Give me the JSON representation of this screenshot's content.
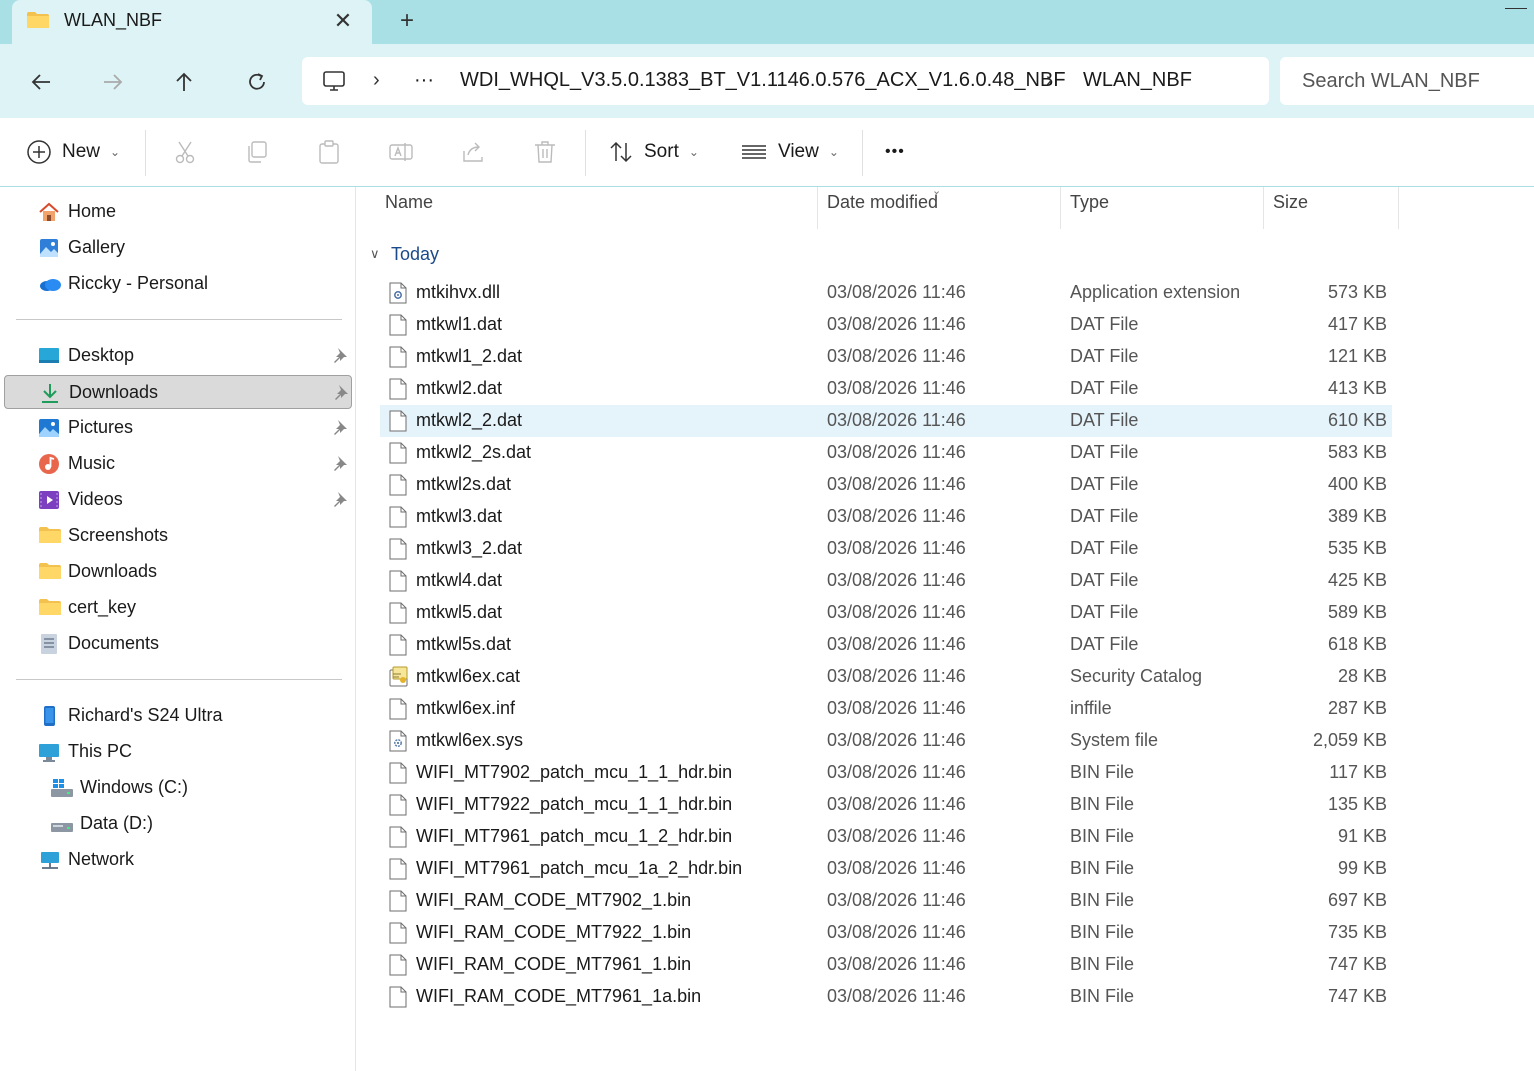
{
  "tab": {
    "title": "WLAN_NBF",
    "close": "✕",
    "new": "+"
  },
  "address": {
    "ellipsis": "···",
    "crumbs": [
      "WDI_WHQL_V3.5.0.1383_BT_V1.1146.0.576_ACX_V1.6.0.48_NBF",
      "WLAN_NBF"
    ],
    "sep": "›"
  },
  "search": {
    "placeholder": "Search WLAN_NBF"
  },
  "toolbar": {
    "new": "New",
    "sort": "Sort",
    "view": "View",
    "more": "•••",
    "chevron": "⌄"
  },
  "sidebar": {
    "top": [
      {
        "label": "Home",
        "icon": "home-icon"
      },
      {
        "label": "Gallery",
        "icon": "gallery-icon"
      },
      {
        "label": "Riccky - Personal",
        "icon": "onedrive-icon"
      }
    ],
    "pinned": [
      {
        "label": "Desktop",
        "icon": "desktop-icon",
        "pinned": true
      },
      {
        "label": "Downloads",
        "icon": "downloads-icon",
        "pinned": true,
        "selected": true
      },
      {
        "label": "Pictures",
        "icon": "pictures-icon",
        "pinned": true
      },
      {
        "label": "Music",
        "icon": "music-icon",
        "pinned": true
      },
      {
        "label": "Videos",
        "icon": "videos-icon",
        "pinned": true
      },
      {
        "label": "Screenshots",
        "icon": "folder-icon"
      },
      {
        "label": "Downloads",
        "icon": "folder-icon"
      },
      {
        "label": "cert_key",
        "icon": "folder-icon"
      },
      {
        "label": "Documents",
        "icon": "documents-icon"
      }
    ],
    "devices": [
      {
        "label": "Richard's S24 Ultra",
        "icon": "phone-icon"
      },
      {
        "label": "This PC",
        "icon": "this-pc-icon"
      },
      {
        "label": "Windows (C:)",
        "icon": "windows-drive-icon"
      },
      {
        "label": "Data (D:)",
        "icon": "drive-icon"
      },
      {
        "label": "Network",
        "icon": "network-icon"
      }
    ]
  },
  "columns": {
    "name": "Name",
    "date": "Date modified",
    "type": "Type",
    "size": "Size"
  },
  "group": {
    "label": "Today"
  },
  "files": [
    {
      "name": "mtkihvx.dll",
      "date": "03/08/2026 11:46",
      "type": "Application extension",
      "size": "573 KB",
      "icon": "dll-file-icon"
    },
    {
      "name": "mtkwl1.dat",
      "date": "03/08/2026 11:46",
      "type": "DAT File",
      "size": "417 KB",
      "icon": "file-icon"
    },
    {
      "name": "mtkwl1_2.dat",
      "date": "03/08/2026 11:46",
      "type": "DAT File",
      "size": "121 KB",
      "icon": "file-icon"
    },
    {
      "name": "mtkwl2.dat",
      "date": "03/08/2026 11:46",
      "type": "DAT File",
      "size": "413 KB",
      "icon": "file-icon"
    },
    {
      "name": "mtkwl2_2.dat",
      "date": "03/08/2026 11:46",
      "type": "DAT File",
      "size": "610 KB",
      "icon": "file-icon",
      "highlighted": true
    },
    {
      "name": "mtkwl2_2s.dat",
      "date": "03/08/2026 11:46",
      "type": "DAT File",
      "size": "583 KB",
      "icon": "file-icon"
    },
    {
      "name": "mtkwl2s.dat",
      "date": "03/08/2026 11:46",
      "type": "DAT File",
      "size": "400 KB",
      "icon": "file-icon"
    },
    {
      "name": "mtkwl3.dat",
      "date": "03/08/2026 11:46",
      "type": "DAT File",
      "size": "389 KB",
      "icon": "file-icon"
    },
    {
      "name": "mtkwl3_2.dat",
      "date": "03/08/2026 11:46",
      "type": "DAT File",
      "size": "535 KB",
      "icon": "file-icon"
    },
    {
      "name": "mtkwl4.dat",
      "date": "03/08/2026 11:46",
      "type": "DAT File",
      "size": "425 KB",
      "icon": "file-icon"
    },
    {
      "name": "mtkwl5.dat",
      "date": "03/08/2026 11:46",
      "type": "DAT File",
      "size": "589 KB",
      "icon": "file-icon"
    },
    {
      "name": "mtkwl5s.dat",
      "date": "03/08/2026 11:46",
      "type": "DAT File",
      "size": "618 KB",
      "icon": "file-icon"
    },
    {
      "name": "mtkwl6ex.cat",
      "date": "03/08/2026 11:46",
      "type": "Security Catalog",
      "size": "28 KB",
      "icon": "catalog-file-icon"
    },
    {
      "name": "mtkwl6ex.inf",
      "date": "03/08/2026 11:46",
      "type": "inffile",
      "size": "287 KB",
      "icon": "file-icon"
    },
    {
      "name": "mtkwl6ex.sys",
      "date": "03/08/2026 11:46",
      "type": "System file",
      "size": "2,059 KB",
      "icon": "sys-file-icon"
    },
    {
      "name": "WIFI_MT7902_patch_mcu_1_1_hdr.bin",
      "date": "03/08/2026 11:46",
      "type": "BIN File",
      "size": "117 KB",
      "icon": "file-icon"
    },
    {
      "name": "WIFI_MT7922_patch_mcu_1_1_hdr.bin",
      "date": "03/08/2026 11:46",
      "type": "BIN File",
      "size": "135 KB",
      "icon": "file-icon"
    },
    {
      "name": "WIFI_MT7961_patch_mcu_1_2_hdr.bin",
      "date": "03/08/2026 11:46",
      "type": "BIN File",
      "size": "91 KB",
      "icon": "file-icon"
    },
    {
      "name": "WIFI_MT7961_patch_mcu_1a_2_hdr.bin",
      "date": "03/08/2026 11:46",
      "type": "BIN File",
      "size": "99 KB",
      "icon": "file-icon"
    },
    {
      "name": "WIFI_RAM_CODE_MT7902_1.bin",
      "date": "03/08/2026 11:46",
      "type": "BIN File",
      "size": "697 KB",
      "icon": "file-icon"
    },
    {
      "name": "WIFI_RAM_CODE_MT7922_1.bin",
      "date": "03/08/2026 11:46",
      "type": "BIN File",
      "size": "735 KB",
      "icon": "file-icon"
    },
    {
      "name": "WIFI_RAM_CODE_MT7961_1.bin",
      "date": "03/08/2026 11:46",
      "type": "BIN File",
      "size": "747 KB",
      "icon": "file-icon"
    },
    {
      "name": "WIFI_RAM_CODE_MT7961_1a.bin",
      "date": "03/08/2026 11:46",
      "type": "BIN File",
      "size": "747 KB",
      "icon": "file-icon"
    }
  ],
  "colors": {
    "accent": "#a9e0e6",
    "nav_bg": "#ddf3f5",
    "highlight": "#e5f3fb",
    "selected": "#dadada"
  }
}
